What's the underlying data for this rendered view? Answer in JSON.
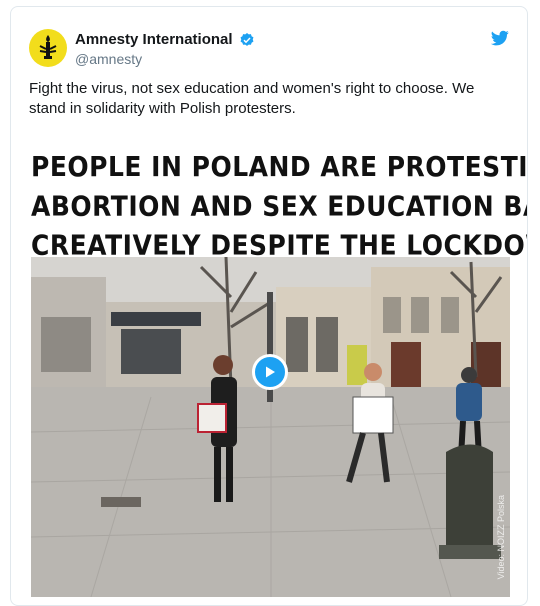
{
  "tweet": {
    "author": {
      "display_name": "Amnesty International",
      "handle": "@amnesty",
      "verified": true,
      "avatar_icon": "amnesty-candle-icon",
      "avatar_color": "#f2dd1c"
    },
    "text": "Fight the virus, not sex education and women's right to choose. We stand in solidarity with Polish protesters.",
    "brand_icon": "twitter-bird-icon",
    "accent_color": "#1da1f2"
  },
  "media": {
    "headline_lines": [
      "PEOPLE IN POLAND ARE PROTESTING",
      "ABORTION AND SEX EDUCATION BANS",
      "CREATIVELY DESPITE THE LOCKDOWN"
    ],
    "video_watermark": "Video: NOIZZ Polska",
    "play_icon": "play-icon"
  }
}
